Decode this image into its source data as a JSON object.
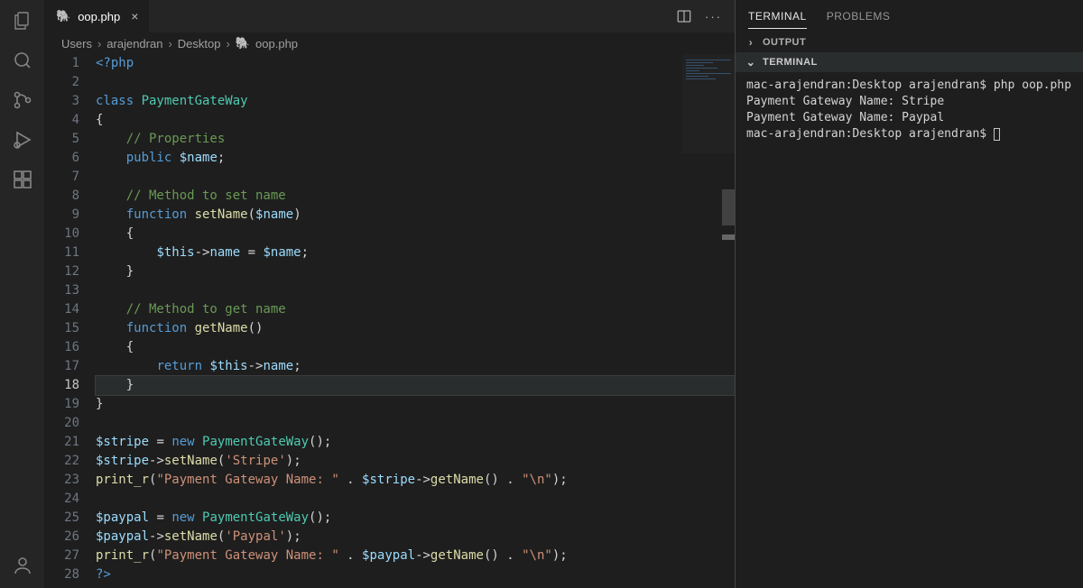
{
  "activity_icons": [
    "files-icon",
    "search-icon",
    "source-control-icon",
    "run-debug-icon",
    "extensions-icon"
  ],
  "account_icon": "account-icon",
  "tab": {
    "label": "oop.php"
  },
  "breadcrumbs": [
    "Users",
    "arajendran",
    "Desktop",
    "oop.php"
  ],
  "panel_tabs": {
    "terminal": "TERMINAL",
    "problems": "PROBLEMS"
  },
  "panel_sections": {
    "output": "OUTPUT",
    "terminal": "TERMINAL"
  },
  "terminal_lines": [
    "mac-arajendran:Desktop arajendran$ php oop.php",
    "Payment Gateway Name: Stripe",
    "Payment Gateway Name: Paypal",
    "mac-arajendran:Desktop arajendran$ "
  ],
  "code": {
    "total_lines": 28,
    "highlighted_line": 18,
    "lines": [
      [
        [
          "t-php",
          "<?php"
        ]
      ],
      [],
      [
        [
          "t-key",
          "class "
        ],
        [
          "t-cls",
          "PaymentGateWay"
        ]
      ],
      [
        [
          "t-pun",
          "{"
        ]
      ],
      [
        [
          "",
          "    "
        ],
        [
          "t-com",
          "// Properties"
        ]
      ],
      [
        [
          "",
          "    "
        ],
        [
          "t-key",
          "public "
        ],
        [
          "t-var",
          "$name"
        ],
        [
          "t-pun",
          ";"
        ]
      ],
      [],
      [
        [
          "",
          "    "
        ],
        [
          "t-com",
          "// Method to set name"
        ]
      ],
      [
        [
          "",
          "    "
        ],
        [
          "t-key",
          "function "
        ],
        [
          "t-fn",
          "setName"
        ],
        [
          "t-pun",
          "("
        ],
        [
          "t-var",
          "$name"
        ],
        [
          "t-pun",
          ")"
        ]
      ],
      [
        [
          "",
          "    "
        ],
        [
          "t-pun",
          "{"
        ]
      ],
      [
        [
          "",
          "        "
        ],
        [
          "t-var",
          "$this"
        ],
        [
          "t-pun",
          "->"
        ],
        [
          "t-var",
          "name"
        ],
        [
          "t-pun",
          " = "
        ],
        [
          "t-var",
          "$name"
        ],
        [
          "t-pun",
          ";"
        ]
      ],
      [
        [
          "",
          "    "
        ],
        [
          "t-pun",
          "}"
        ]
      ],
      [],
      [
        [
          "",
          "    "
        ],
        [
          "t-com",
          "// Method to get name"
        ]
      ],
      [
        [
          "",
          "    "
        ],
        [
          "t-key",
          "function "
        ],
        [
          "t-fn",
          "getName"
        ],
        [
          "t-pun",
          "()"
        ]
      ],
      [
        [
          "",
          "    "
        ],
        [
          "t-pun",
          "{"
        ]
      ],
      [
        [
          "",
          "        "
        ],
        [
          "t-key",
          "return "
        ],
        [
          "t-var",
          "$this"
        ],
        [
          "t-pun",
          "->"
        ],
        [
          "t-var",
          "name"
        ],
        [
          "t-pun",
          ";"
        ]
      ],
      [
        [
          "",
          "    "
        ],
        [
          "t-pun",
          "}"
        ]
      ],
      [
        [
          "t-pun",
          "}"
        ]
      ],
      [],
      [
        [
          "t-var",
          "$stripe"
        ],
        [
          "t-pun",
          " = "
        ],
        [
          "t-key",
          "new "
        ],
        [
          "t-cls",
          "PaymentGateWay"
        ],
        [
          "t-pun",
          "();"
        ]
      ],
      [
        [
          "t-var",
          "$stripe"
        ],
        [
          "t-pun",
          "->"
        ],
        [
          "t-fn",
          "setName"
        ],
        [
          "t-pun",
          "("
        ],
        [
          "t-str",
          "'Stripe'"
        ],
        [
          "t-pun",
          ");"
        ]
      ],
      [
        [
          "t-fn",
          "print_r"
        ],
        [
          "t-pun",
          "("
        ],
        [
          "t-str",
          "\"Payment Gateway Name: \""
        ],
        [
          "t-pun",
          " . "
        ],
        [
          "t-var",
          "$stripe"
        ],
        [
          "t-pun",
          "->"
        ],
        [
          "t-fn",
          "getName"
        ],
        [
          "t-pun",
          "() . "
        ],
        [
          "t-str",
          "\"\\n\""
        ],
        [
          "t-pun",
          ");"
        ]
      ],
      [],
      [
        [
          "t-var",
          "$paypal"
        ],
        [
          "t-pun",
          " = "
        ],
        [
          "t-key",
          "new "
        ],
        [
          "t-cls",
          "PaymentGateWay"
        ],
        [
          "t-pun",
          "();"
        ]
      ],
      [
        [
          "t-var",
          "$paypal"
        ],
        [
          "t-pun",
          "->"
        ],
        [
          "t-fn",
          "setName"
        ],
        [
          "t-pun",
          "("
        ],
        [
          "t-str",
          "'Paypal'"
        ],
        [
          "t-pun",
          ");"
        ]
      ],
      [
        [
          "t-fn",
          "print_r"
        ],
        [
          "t-pun",
          "("
        ],
        [
          "t-str",
          "\"Payment Gateway Name: \""
        ],
        [
          "t-pun",
          " . "
        ],
        [
          "t-var",
          "$paypal"
        ],
        [
          "t-pun",
          "->"
        ],
        [
          "t-fn",
          "getName"
        ],
        [
          "t-pun",
          "() . "
        ],
        [
          "t-str",
          "\"\\n\""
        ],
        [
          "t-pun",
          ");"
        ]
      ],
      [
        [
          "t-php",
          "?>"
        ]
      ]
    ]
  }
}
